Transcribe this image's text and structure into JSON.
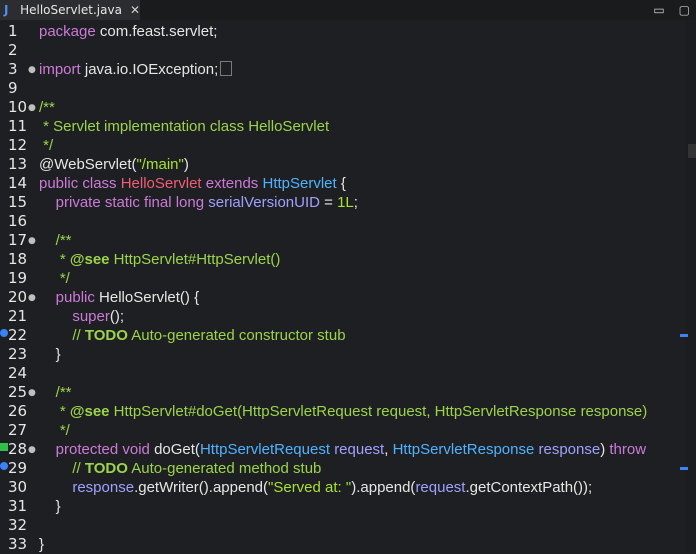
{
  "tab": {
    "icon": "java-file-icon",
    "title": "HelloServlet.java",
    "close": "✕"
  },
  "window_controls": {
    "minimize": "▭",
    "maximize": "▢"
  },
  "code_lines": [
    {
      "n": "1",
      "text": "package com.feast.servlet;"
    },
    {
      "n": "2",
      "text": ""
    },
    {
      "n": "3",
      "text": "import java.io.IOException;"
    },
    {
      "n": "9",
      "text": ""
    },
    {
      "n": "10",
      "text": "/**"
    },
    {
      "n": "11",
      "text": " * Servlet implementation class HelloServlet"
    },
    {
      "n": "12",
      "text": " */"
    },
    {
      "n": "13",
      "text": "@WebServlet(\"/main\")"
    },
    {
      "n": "14",
      "text": "public class HelloServlet extends HttpServlet {"
    },
    {
      "n": "15",
      "text": "    private static final long serialVersionUID = 1L;"
    },
    {
      "n": "16",
      "text": ""
    },
    {
      "n": "17",
      "text": "    /**"
    },
    {
      "n": "18",
      "text": "     * @see HttpServlet#HttpServlet()"
    },
    {
      "n": "19",
      "text": "     */"
    },
    {
      "n": "20",
      "text": "    public HelloServlet() {"
    },
    {
      "n": "21",
      "text": "        super();"
    },
    {
      "n": "22",
      "text": "        // TODO Auto-generated constructor stub"
    },
    {
      "n": "23",
      "text": "    }"
    },
    {
      "n": "24",
      "text": ""
    },
    {
      "n": "25",
      "text": "    /**"
    },
    {
      "n": "26",
      "text": "     * @see HttpServlet#doGet(HttpServletRequest request, HttpServletResponse response)"
    },
    {
      "n": "27",
      "text": "     */"
    },
    {
      "n": "28",
      "text": "    protected void doGet(HttpServletRequest request, HttpServletResponse response) throw"
    },
    {
      "n": "29",
      "text": "        // TODO Auto-generated method stub"
    },
    {
      "n": "30",
      "text": "        response.getWriter().append(\"Served at: \").append(request.getContextPath());"
    },
    {
      "n": "31",
      "text": "    }"
    },
    {
      "n": "32",
      "text": ""
    },
    {
      "n": "33",
      "text": "}"
    }
  ],
  "colors": {
    "background": "#1e1f22",
    "keyword": "#cc7ad8",
    "comment": "#9bd44a",
    "string": "#a6e22e",
    "class_name": "#ef5d76",
    "type": "#4fb3ff",
    "variable": "#a0a0ff",
    "text": "#e6e6e6"
  }
}
